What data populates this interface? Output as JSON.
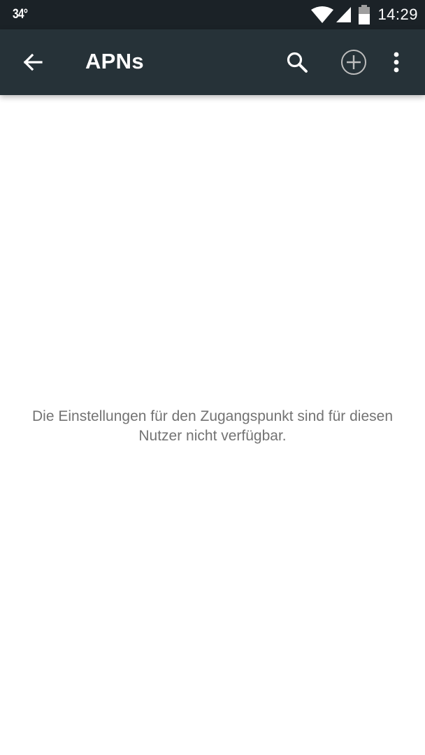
{
  "status_bar": {
    "temperature": "34°",
    "time": "14:29",
    "icons": [
      "wifi-icon",
      "signal-icon",
      "battery-icon"
    ]
  },
  "toolbar": {
    "title": "APNs",
    "back_icon": "arrow-back-icon",
    "actions": [
      "search-icon",
      "add-circle-icon",
      "more-vert-icon"
    ]
  },
  "main": {
    "message": "Die Einstellungen für den Zugangspunkt sind für diesen Nutzer nicht verfügbar."
  },
  "colors": {
    "status_bar": "#1b2227",
    "toolbar": "#263238",
    "background": "#ffffff",
    "message_text": "#737373"
  }
}
